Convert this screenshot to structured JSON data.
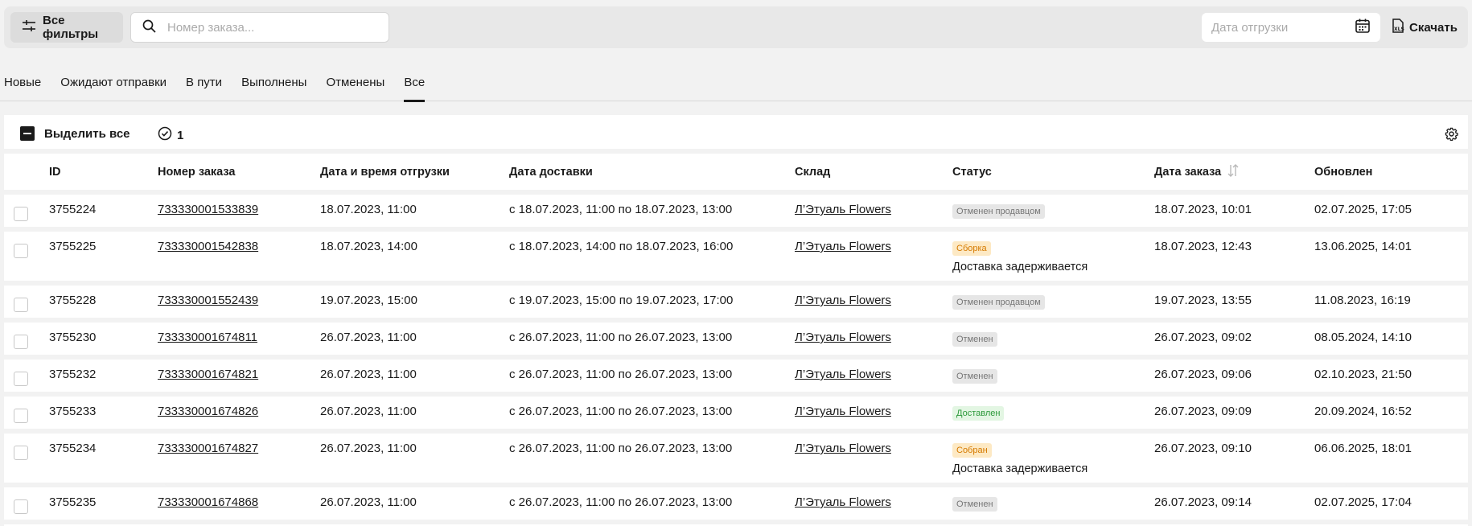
{
  "toolbar": {
    "filters_label": "Все фильтры",
    "search_placeholder": "Номер заказа...",
    "date_placeholder": "Дата отгрузки",
    "download_label": "Скачать"
  },
  "tabs": [
    {
      "label": "Новые"
    },
    {
      "label": "Ожидают отправки"
    },
    {
      "label": "В пути"
    },
    {
      "label": "Выполнены"
    },
    {
      "label": "Отменены"
    },
    {
      "label": "Все",
      "active": true
    }
  ],
  "panel": {
    "select_all_label": "Выделить все",
    "selected_count": "1"
  },
  "table": {
    "columns": [
      "ID",
      "Номер заказа",
      "Дата и время отгрузки",
      "Дата доставки",
      "Склад",
      "Статус",
      "Дата заказа",
      "Обновлен"
    ],
    "rows": [
      {
        "id": "3755224",
        "order": "733330001533839",
        "ship": "18.07.2023, 11:00",
        "delivery": "с 18.07.2023, 11:00 по 18.07.2023, 13:00",
        "warehouse": "Л’Этуаль Flowers",
        "status": "Отменен продавцом",
        "status_color": "grey",
        "note": "",
        "ordered": "18.07.2023, 10:01",
        "updated": "02.07.2025, 17:05"
      },
      {
        "id": "3755225",
        "order": "733330001542838",
        "ship": "18.07.2023, 14:00",
        "delivery": "с 18.07.2023, 14:00 по 18.07.2023, 16:00",
        "warehouse": "Л’Этуаль Flowers",
        "status": "Сборка",
        "status_color": "orange",
        "note": "Доставка задерживается",
        "ordered": "18.07.2023, 12:43",
        "updated": "13.06.2025, 14:01"
      },
      {
        "id": "3755228",
        "order": "733330001552439",
        "ship": "19.07.2023, 15:00",
        "delivery": "с 19.07.2023, 15:00 по 19.07.2023, 17:00",
        "warehouse": "Л’Этуаль Flowers",
        "status": "Отменен продавцом",
        "status_color": "grey",
        "note": "",
        "ordered": "19.07.2023, 13:55",
        "updated": "11.08.2023, 16:19"
      },
      {
        "id": "3755230",
        "order": "733330001674811",
        "ship": "26.07.2023, 11:00",
        "delivery": "с 26.07.2023, 11:00 по 26.07.2023, 13:00",
        "warehouse": "Л’Этуаль Flowers",
        "status": "Отменен",
        "status_color": "grey",
        "note": "",
        "ordered": "26.07.2023, 09:02",
        "updated": "08.05.2024, 14:10"
      },
      {
        "id": "3755232",
        "order": "733330001674821",
        "ship": "26.07.2023, 11:00",
        "delivery": "с 26.07.2023, 11:00 по 26.07.2023, 13:00",
        "warehouse": "Л’Этуаль Flowers",
        "status": "Отменен",
        "status_color": "grey",
        "note": "",
        "ordered": "26.07.2023, 09:06",
        "updated": "02.10.2023, 21:50"
      },
      {
        "id": "3755233",
        "order": "733330001674826",
        "ship": "26.07.2023, 11:00",
        "delivery": "с 26.07.2023, 11:00 по 26.07.2023, 13:00",
        "warehouse": "Л’Этуаль Flowers",
        "status": "Доставлен",
        "status_color": "green",
        "note": "",
        "ordered": "26.07.2023, 09:09",
        "updated": "20.09.2024, 16:52"
      },
      {
        "id": "3755234",
        "order": "733330001674827",
        "ship": "26.07.2023, 11:00",
        "delivery": "с 26.07.2023, 11:00 по 26.07.2023, 13:00",
        "warehouse": "Л’Этуаль Flowers",
        "status": "Собран",
        "status_color": "orange",
        "note": "Доставка задерживается",
        "ordered": "26.07.2023, 09:10",
        "updated": "06.06.2025, 18:01"
      },
      {
        "id": "3755235",
        "order": "733330001674868",
        "ship": "26.07.2023, 11:00",
        "delivery": "с 26.07.2023, 11:00 по 26.07.2023, 13:00",
        "warehouse": "Л’Этуаль Flowers",
        "status": "Отменен",
        "status_color": "grey",
        "note": "",
        "ordered": "26.07.2023, 09:14",
        "updated": "02.07.2025, 17:04"
      }
    ]
  }
}
